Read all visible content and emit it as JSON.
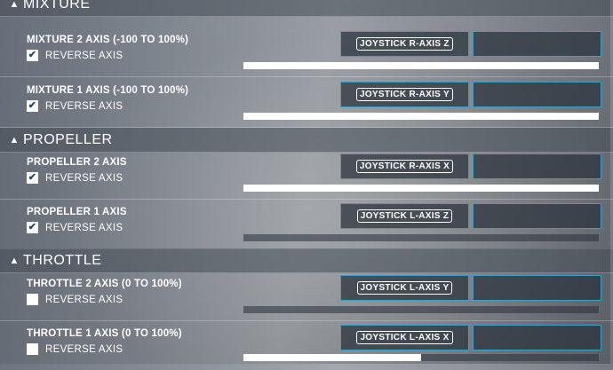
{
  "sections": [
    {
      "title": "MIXTURE",
      "collapsed": false
    },
    {
      "title": "PROPELLER",
      "collapsed": false
    },
    {
      "title": "THROTTLE",
      "collapsed": false
    }
  ],
  "reverse_label": "REVERSE AXIS",
  "rows": [
    {
      "label": "MIXTURE 2 AXIS (-100 TO 100%)",
      "reverse": true,
      "binding": "JOYSTICK R-AXIS Z",
      "binding2": "",
      "bar_fraction": 1.0
    },
    {
      "label": "MIXTURE 1 AXIS (-100 TO 100%)",
      "reverse": true,
      "binding": "JOYSTICK R-AXIS Y",
      "binding2": "",
      "bar_fraction": 1.0
    },
    {
      "label": "PROPELLER 2 AXIS",
      "reverse": true,
      "binding": "JOYSTICK R-AXIS X",
      "binding2": "",
      "bar_fraction": 1.0
    },
    {
      "label": "PROPELLER 1 AXIS",
      "reverse": true,
      "binding": "JOYSTICK L-AXIS Z",
      "binding2": "",
      "bar_fraction": 0.0
    },
    {
      "label": "THROTTLE 2 AXIS (0 TO 100%)",
      "reverse": false,
      "binding": "JOYSTICK L-AXIS Y",
      "binding2": "",
      "bar_fraction": 0.0
    },
    {
      "label": "THROTTLE 1 AXIS (0 TO 100%)",
      "reverse": false,
      "binding": "JOYSTICK L-AXIS X",
      "binding2": "",
      "bar_fraction": 0.5
    }
  ],
  "colors": {
    "accent": "#3aa0c8",
    "bar_fill": "#ffffff"
  },
  "icons": {
    "section_toggle": "chevron-up-icon",
    "checked": "check-icon"
  }
}
